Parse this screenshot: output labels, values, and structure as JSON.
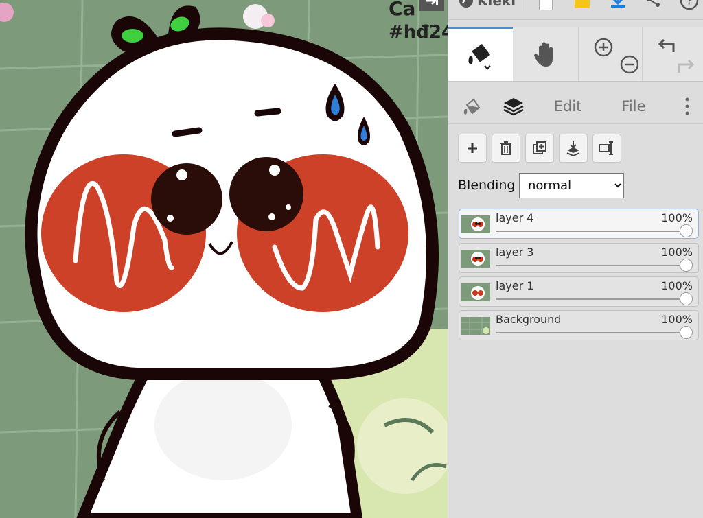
{
  "canvas": {
    "overlay_text_line1": "Ca",
    "overlay_text_line2": "#hđ24"
  },
  "app": {
    "name": "Kleki"
  },
  "topbar_icons": [
    "fullscreen-icon",
    "kleki-logo",
    "new-image-icon",
    "open-folder-icon",
    "download-icon",
    "share-icon",
    "help-icon"
  ],
  "tools": [
    {
      "name": "fill-tool",
      "icon": "paint-bucket-icon",
      "active": true
    },
    {
      "name": "hand-tool",
      "icon": "hand-icon",
      "active": false
    },
    {
      "name": "zoom-tool",
      "icon": "zoom-in-out-icon",
      "active": false
    },
    {
      "name": "undo-redo",
      "icon": "undo-redo-icon",
      "active": false
    }
  ],
  "tabs": {
    "brush_icon": "fill-bucket-tab-icon",
    "layers_icon": "layers-icon",
    "edit": "Edit",
    "file": "File",
    "more_icon": "more-vertical-icon"
  },
  "layer_buttons": [
    "add-layer-icon",
    "delete-layer-icon",
    "duplicate-layer-icon",
    "merge-down-icon",
    "rename-layer-icon"
  ],
  "blending": {
    "label": "Blending",
    "value": "normal",
    "options": [
      "normal"
    ]
  },
  "layers": [
    {
      "name": "layer 4",
      "opacity": "100%",
      "opacity_value": 1.0,
      "active": true
    },
    {
      "name": "layer 3",
      "opacity": "100%",
      "opacity_value": 1.0,
      "active": false
    },
    {
      "name": "layer 1",
      "opacity": "100%",
      "opacity_value": 1.0,
      "active": false
    },
    {
      "name": "Background",
      "opacity": "100%",
      "opacity_value": 1.0,
      "active": false
    }
  ],
  "colors": {
    "accent": "#4d8ad6",
    "canvas_bg": "#7a9a7a",
    "cheek": "#c9371c",
    "outline": "#1a0606"
  }
}
